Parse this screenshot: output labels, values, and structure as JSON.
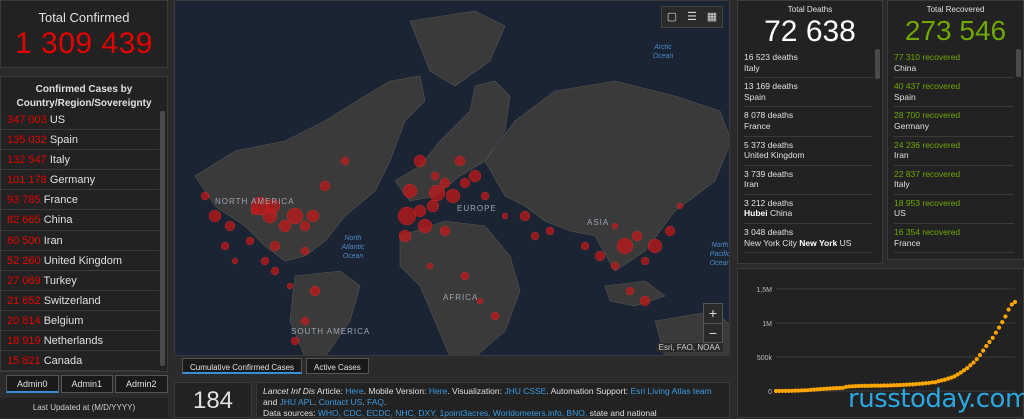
{
  "total_confirmed": {
    "label": "Total Confirmed",
    "value": "1 309 439"
  },
  "country_panel": {
    "title": "Confirmed Cases by Country/Region/Sovereignty",
    "rows": [
      {
        "count": "347 003",
        "name": "US"
      },
      {
        "count": "135 032",
        "name": "Spain"
      },
      {
        "count": "132 547",
        "name": "Italy"
      },
      {
        "count": "101 178",
        "name": "Germany"
      },
      {
        "count": "93 785",
        "name": "France"
      },
      {
        "count": "82 665",
        "name": "China"
      },
      {
        "count": "60 500",
        "name": "Iran"
      },
      {
        "count": "52 260",
        "name": "United Kingdom"
      },
      {
        "count": "27 069",
        "name": "Turkey"
      },
      {
        "count": "21 652",
        "name": "Switzerland"
      },
      {
        "count": "20 814",
        "name": "Belgium"
      },
      {
        "count": "18 919",
        "name": "Netherlands"
      },
      {
        "count": "15 821",
        "name": "Canada"
      }
    ]
  },
  "admin_tabs": [
    "Admin0",
    "Admin1",
    "Admin2"
  ],
  "last_updated": {
    "label": "Last Updated at (M/D/YYYY)"
  },
  "map": {
    "labels": {
      "north_america": "NORTH AMERICA",
      "europe": "EUROPE",
      "asia": "ASIA",
      "africa": "AFRICA",
      "south_america": "SOUTH AMERICA"
    },
    "oceans": {
      "arctic": "Arctic Ocean",
      "north_atlantic": "North Atlantic Ocean",
      "north_pacific": "North Pacific Ocean"
    },
    "attribution": "Esri, FAO, NOAA",
    "zoom_in": "+",
    "zoom_out": "−"
  },
  "map_tabs": [
    "Cumulative Confirmed Cases",
    "Active Cases"
  ],
  "bottom": {
    "count": "184",
    "line1_a": "Lancet Inf Dis",
    "line1_b": " Article: ",
    "here1": "Here",
    "line1_c": ". Mobile Version: ",
    "here2": "Here",
    "line1_d": ". Visualization: ",
    "jhu": "JHU CSSE",
    "line1_e": ". Automation Support: ",
    "esri": "Esri Living Atlas team",
    "and": " and ",
    "jhuapl": "JHU APL",
    "dot": ". ",
    "contact": "Contact US",
    "dot2": ". ",
    "faq": "FAQ",
    "dot3": ".",
    "sources_label": "Data sources: ",
    "sources": "WHO, CDC, ECDC, NHC, DXY, 1point3acres, Worldometers.info, BNO,",
    "sources_tail": " state and national"
  },
  "deaths": {
    "label": "Total Deaths",
    "value": "72 638",
    "rows": [
      {
        "value": "16 523 deaths",
        "place": "Italy",
        "bold": ""
      },
      {
        "value": "13 169 deaths",
        "place": "Spain",
        "bold": ""
      },
      {
        "value": "8 078 deaths",
        "place": "France",
        "bold": ""
      },
      {
        "value": "5 373 deaths",
        "place": "United Kingdom",
        "bold": ""
      },
      {
        "value": "3 739 deaths",
        "place": "Iran",
        "bold": ""
      },
      {
        "value": "3 212 deaths",
        "place": " China",
        "bold": "Hubei"
      },
      {
        "value": "3 048 deaths",
        "place_pre": "New York City ",
        "bold": "New York",
        "place": " US"
      }
    ]
  },
  "recovered": {
    "label": "Total Recovered",
    "value": "273 546",
    "rows": [
      {
        "value": "77 310 recovered",
        "place": "China"
      },
      {
        "value": "40 437 recovered",
        "place": "Spain"
      },
      {
        "value": "28 700 recovered",
        "place": "Germany"
      },
      {
        "value": "24 236 recovered",
        "place": "Iran"
      },
      {
        "value": "22 837 recovered",
        "place": "Italy"
      },
      {
        "value": "18 953 recovered",
        "place": "US"
      },
      {
        "value": "16 354 recovered",
        "place": "France"
      }
    ]
  },
  "chart_data": {
    "type": "scatter",
    "y_ticks": [
      "0",
      "500k",
      "1M",
      "1,5M"
    ],
    "ylim": [
      0,
      1500000
    ],
    "x": [
      1,
      2,
      3,
      4,
      5,
      6,
      7,
      8,
      9,
      10,
      11,
      12,
      13,
      14,
      15,
      16,
      17,
      18,
      19,
      20,
      21,
      22,
      23,
      24,
      25,
      26,
      27,
      28,
      29,
      30,
      31,
      32,
      33,
      34,
      35,
      36,
      37,
      38,
      39,
      40,
      41,
      42,
      43,
      44,
      45,
      46,
      47,
      48,
      49,
      50,
      51,
      52,
      53,
      54,
      55,
      56,
      57,
      58,
      59,
      60,
      61,
      62,
      63,
      64,
      65,
      66,
      67,
      68,
      69,
      70,
      71,
      72,
      73,
      74,
      75,
      76
    ],
    "values": [
      555,
      654,
      941,
      1434,
      2118,
      2927,
      5578,
      6166,
      8234,
      9927,
      12038,
      16787,
      19881,
      23892,
      27635,
      30794,
      34391,
      37120,
      40150,
      42762,
      44802,
      45221,
      60368,
      66885,
      69030,
      71224,
      73258,
      75136,
      75639,
      76197,
      76819,
      78572,
      78958,
      79561,
      80406,
      81388,
      82746,
      84112,
      86011,
      88369,
      90306,
      92840,
      95120,
      97886,
      101801,
      105847,
      109821,
      113590,
      118620,
      125875,
      128352,
      145205,
      156101,
      167454,
      181574,
      197102,
      214821,
      242570,
      272208,
      304507,
      336953,
      378235,
      418045,
      467653,
      529591,
      593291,
      660706,
      720117,
      782365,
      857487,
      932605,
      1013157,
      1095917,
      1197405,
      1272115,
      1309439
    ],
    "color": "#ffa500"
  },
  "watermark": "russtoday.com"
}
